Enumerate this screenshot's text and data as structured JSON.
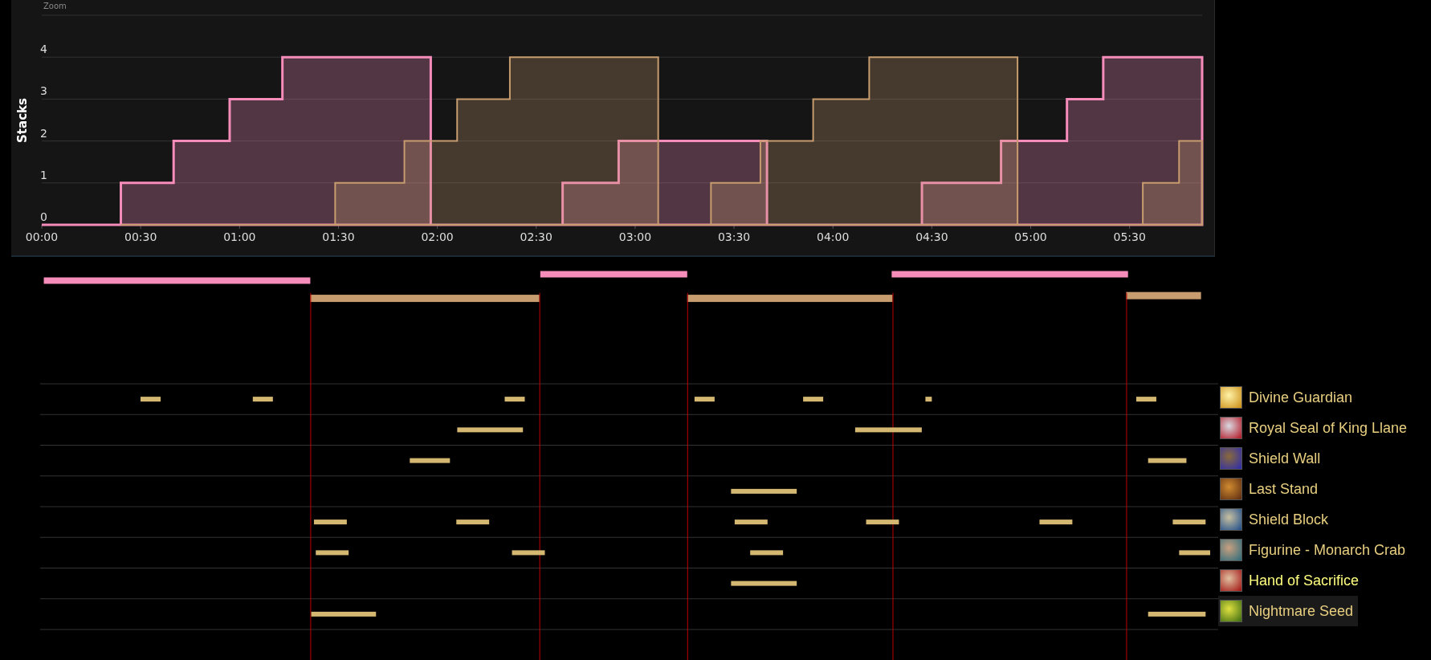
{
  "chart": {
    "zoom_label": "Zoom",
    "chart_data": {
      "type": "area",
      "stacked": false,
      "ylabel": "Stacks",
      "grid": true,
      "x": [
        0,
        24,
        24,
        40,
        40,
        57,
        57,
        73,
        73,
        89,
        89,
        110,
        110,
        118,
        118,
        126,
        126,
        142,
        142,
        158,
        158,
        175,
        175,
        187,
        187,
        203,
        203,
        218,
        218,
        220,
        220,
        234,
        234,
        251,
        251,
        267,
        267,
        291,
        291,
        296,
        296,
        311,
        311,
        322,
        322,
        334,
        334,
        345,
        345,
        352
      ],
      "series": [
        {
          "color": "#f58cba",
          "values": [
            0,
            0,
            1,
            1,
            2,
            2,
            3,
            3,
            4,
            4,
            4,
            4,
            4,
            4,
            0,
            0,
            0,
            0,
            0,
            0,
            1,
            1,
            2,
            2,
            2,
            2,
            2,
            2,
            2,
            2,
            0,
            0,
            0,
            0,
            0,
            0,
            1,
            1,
            2,
            2,
            2,
            2,
            3,
            3,
            4,
            4,
            4,
            4,
            4,
            4
          ]
        },
        {
          "color": "#c79c6e",
          "values": [
            null,
            0,
            0,
            0,
            0,
            0,
            0,
            0,
            0,
            0,
            1,
            1,
            2,
            2,
            2,
            2,
            3,
            3,
            4,
            4,
            4,
            4,
            4,
            4,
            0,
            0,
            1,
            1,
            2,
            2,
            2,
            2,
            3,
            3,
            4,
            4,
            4,
            4,
            4,
            4,
            0,
            0,
            0,
            0,
            0,
            0,
            1,
            1,
            2,
            2
          ]
        }
      ],
      "xlim": [
        0,
        352
      ],
      "ylim": [
        0,
        5
      ],
      "xticks": [
        {
          "value": 0,
          "label": "00:00"
        },
        {
          "value": 30,
          "label": "00:30"
        },
        {
          "value": 60,
          "label": "01:00"
        },
        {
          "value": 90,
          "label": "01:30"
        },
        {
          "value": 120,
          "label": "02:00"
        },
        {
          "value": 150,
          "label": "02:30"
        },
        {
          "value": 180,
          "label": "03:00"
        },
        {
          "value": 210,
          "label": "03:30"
        },
        {
          "value": 240,
          "label": "04:00"
        },
        {
          "value": 270,
          "label": "04:30"
        },
        {
          "value": 300,
          "label": "05:00"
        },
        {
          "value": 330,
          "label": "05:30"
        }
      ],
      "yticks": [
        0,
        1,
        2,
        3,
        4
      ]
    }
  },
  "abilities": [
    {
      "name": "Divine Guardian",
      "selected": false,
      "emphasized": false
    },
    {
      "name": "Royal Seal of King Llane",
      "selected": false,
      "emphasized": false
    },
    {
      "name": "Shield Wall",
      "selected": false,
      "emphasized": false
    },
    {
      "name": "Last Stand",
      "selected": false,
      "emphasized": false
    },
    {
      "name": "Shield Block",
      "selected": false,
      "emphasized": false
    },
    {
      "name": "Figurine - Monarch Crab",
      "selected": false,
      "emphasized": false
    },
    {
      "name": "Hand of Sacrifice",
      "selected": false,
      "emphasized": true
    },
    {
      "name": "Nightmare Seed",
      "selected": true,
      "emphasized": false
    }
  ]
}
